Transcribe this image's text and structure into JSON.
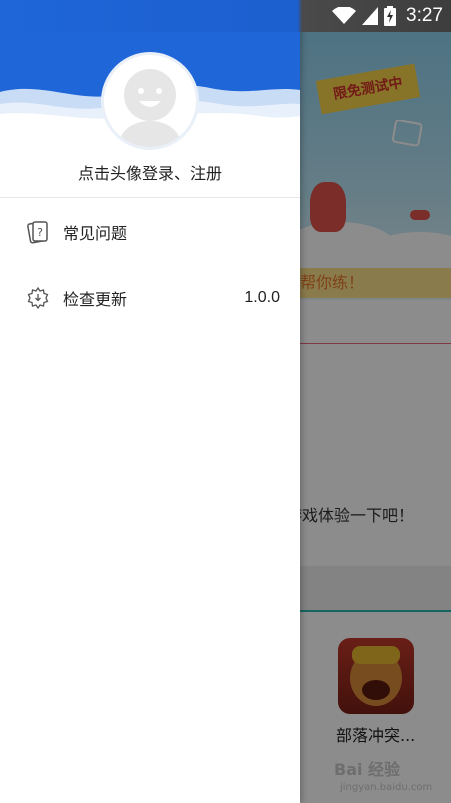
{
  "status_bar": {
    "time": "3:27"
  },
  "drawer": {
    "login_prompt": "点击头像登录、注册",
    "items": [
      {
        "label": "常见问题",
        "icon": "faq-card-icon"
      },
      {
        "label": "检查更新",
        "icon": "update-gear-icon",
        "value": "1.0.0"
      }
    ]
  },
  "background_app": {
    "banner_tag": "限免测试中",
    "banner_strip": "帮你练！",
    "prompt_text": "游戏体验一下吧！",
    "game_name": "部落冲突...",
    "watermark": "Bai 经验",
    "watermark_sub": "jingyan.baidu.com"
  },
  "colors": {
    "header_blue": "#1f66d9",
    "scrim": "rgba(0,0,0,0.45)"
  }
}
